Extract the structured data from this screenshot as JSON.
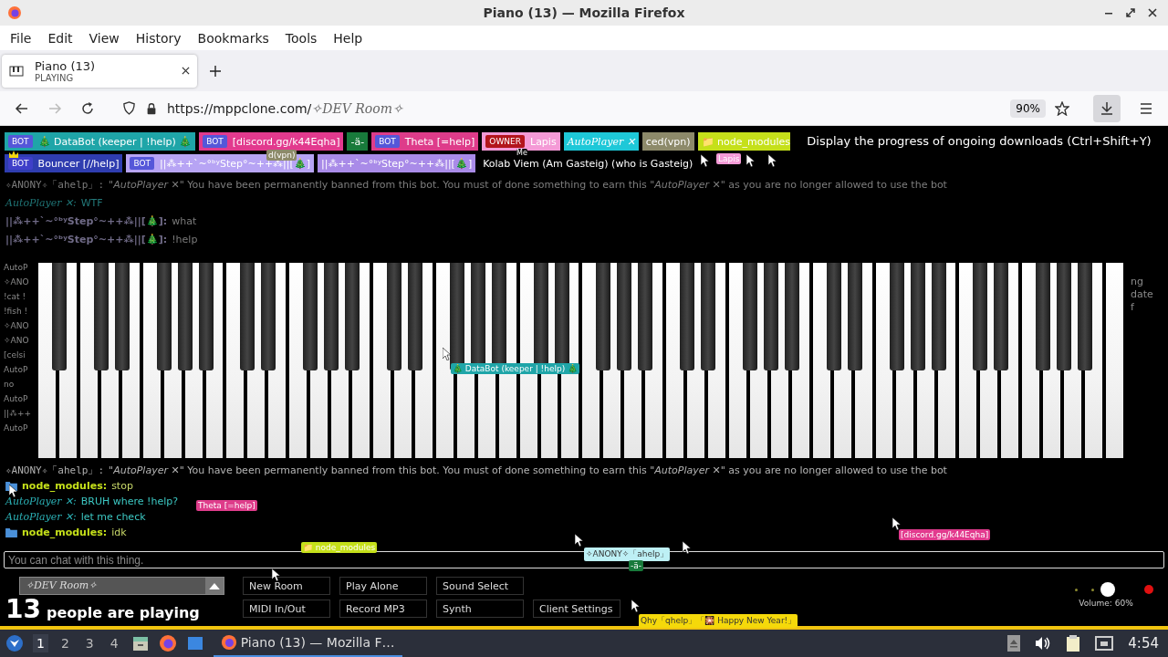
{
  "window": {
    "title": "Piano (13) — Mozilla Firefox"
  },
  "menu": [
    "File",
    "Edit",
    "View",
    "History",
    "Bookmarks",
    "Tools",
    "Help"
  ],
  "tabs": [
    {
      "title": "Piano (13)",
      "subtitle": "PLAYING",
      "selected": true
    }
  ],
  "nav": {
    "forward_disabled": true,
    "url_host": "https://mppclone.com/",
    "url_path": "✧DEV Room✧",
    "zoom": "90%"
  },
  "tooltip": "Display the progress of ongoing downloads (Ctrl+Shift+Y)",
  "user_rows": [
    {
      "users": [
        {
          "badge": {
            "text": "BOT",
            "color": "#5557d9"
          },
          "name": "🎄 DataBot (keeper | !help) 🎄",
          "color": "#1fa5a8"
        },
        {
          "badge": {
            "text": "BOT",
            "color": "#5557d9"
          },
          "name": "[discord.gg/k44Eqha]",
          "color": "#e23a8e"
        },
        {
          "name": "-ä-",
          "color": "#187a3b"
        },
        {
          "badge": {
            "text": "BOT",
            "color": "#5557d9"
          },
          "name": "Theta [=help]",
          "color": "#de3c8a"
        },
        {
          "badge": {
            "text": "OWNER",
            "color": "#b3151c"
          },
          "name": "Lapis",
          "color": "#f49ad6"
        },
        {
          "name": "AutoPlayer ✕",
          "color": "#1ec8d8",
          "script": true
        },
        {
          "name": "ced(vpn)",
          "color": "#8d8a6a"
        },
        {
          "name": "📁 node_modules",
          "color": "#c5e01a"
        }
      ]
    },
    {
      "users": [
        {
          "badge": {
            "text": "BOT",
            "color": "#3f3fc9"
          },
          "name": "Bouncer [//help]",
          "color": "#2f3db0"
        },
        {
          "badge": {
            "text": "BOT",
            "color": "#5557d9"
          },
          "name": "||⁂++`~°ᵇʸStep°~++⁂||[🎄]",
          "color": "#b7a4f4"
        },
        {
          "name": "||⁂++`~°ᵇʸStep°~++⁂||[🎄]",
          "color": "#a98be8"
        },
        {
          "name": "Kolab Viem (Am Gasteig) (who is Gasteig)"
        }
      ]
    }
  ],
  "chat_top": [
    {
      "name": "✧ANONY✧「ahelp」:",
      "kind": "mono",
      "text": "\"*AutoPlayer ✕*\" You have been permanently banned from this bot. You must of done something to earn this \"*AutoPlayer ✕*\" as you are no longer allowed to use the bot"
    },
    {
      "name": "AutoPlayer ✕:",
      "kind": "script",
      "text": "WTF"
    },
    {
      "name": "||⁂++`~°ᵇʸStep°~++⁂||[🎄]:",
      "kind": "bold",
      "text": "what"
    },
    {
      "name": "||⁂++`~°ᵇʸStep°~++⁂||[🎄]:",
      "kind": "bold",
      "text": "!help"
    }
  ],
  "side_left": [
    "AutoP",
    "✧ANO",
    "!cat !",
    "!fish !",
    "✧ANO",
    "✧ANO",
    "[celsi",
    "AutoP",
    "no",
    "AutoP",
    "||⁂++",
    "AutoP"
  ],
  "side_right": [
    "ng",
    "date",
    "f"
  ],
  "cursors": [
    {
      "name": "d(vpn)",
      "color": "#8d8a6a"
    },
    {
      "name": "Me",
      "color": "#000000"
    },
    {
      "name": "Lapis",
      "color": "#f49ad6"
    },
    {
      "name": "🎄 DataBot (keeper | !help) 🎄",
      "color": "#1fa5a8"
    },
    {
      "name": "Theta [=help]",
      "color": "#de3c8a"
    },
    {
      "name": "📁 node_modules",
      "color": "#c5e01a"
    },
    {
      "name": "[discord.gg/k44Eqha]",
      "color": "#e23a8e"
    },
    {
      "name": "✧ANONY✧「ahelp」",
      "color": "#bdf0f5"
    },
    {
      "name": "-ä-",
      "color": "#187a3b"
    },
    {
      "name": "Qhy「qhelp」「🎇 Happy New Year!」",
      "color": "#f5d90a"
    }
  ],
  "chat_bottom": [
    {
      "name": "✧ANONY✧「ahelp」:",
      "kind": "mono",
      "text": "\"*AutoPlayer ✕*\" You have been permanently banned from this bot. You must of done something to earn this \"*AutoPlayer ✕*\" as you are no longer allowed to use the bot"
    },
    {
      "name": "node_modules:",
      "kind": "folder",
      "text": "stop"
    },
    {
      "name": "AutoPlayer ✕:",
      "kind": "script",
      "text": "BRUH where !help?"
    },
    {
      "name": "AutoPlayer ✕:",
      "kind": "script",
      "text": "let me check"
    },
    {
      "name": "node_modules:",
      "kind": "folder",
      "text": "idk"
    }
  ],
  "chat_input": {
    "placeholder": "You can chat with this thing."
  },
  "room": {
    "name": "✧DEV Room✧"
  },
  "player_count": {
    "number": "13",
    "label": "people are playing"
  },
  "buttons": [
    "New Room",
    "Play Alone",
    "Sound Select",
    "MIDI In/Out",
    "Record MP3",
    "Synth",
    "Client Settings"
  ],
  "volume": {
    "label": "Volume: 60%",
    "level": 0.6
  },
  "taskbar": {
    "workspaces": [
      {
        "label": "1",
        "selected": true
      },
      {
        "label": "2",
        "selected": false
      },
      {
        "label": "3",
        "selected": false
      },
      {
        "label": "4",
        "selected": false
      }
    ],
    "tasks": [
      {
        "title": "Piano (13) — Mozilla F…",
        "selected": true
      }
    ],
    "clock": "4:54"
  }
}
